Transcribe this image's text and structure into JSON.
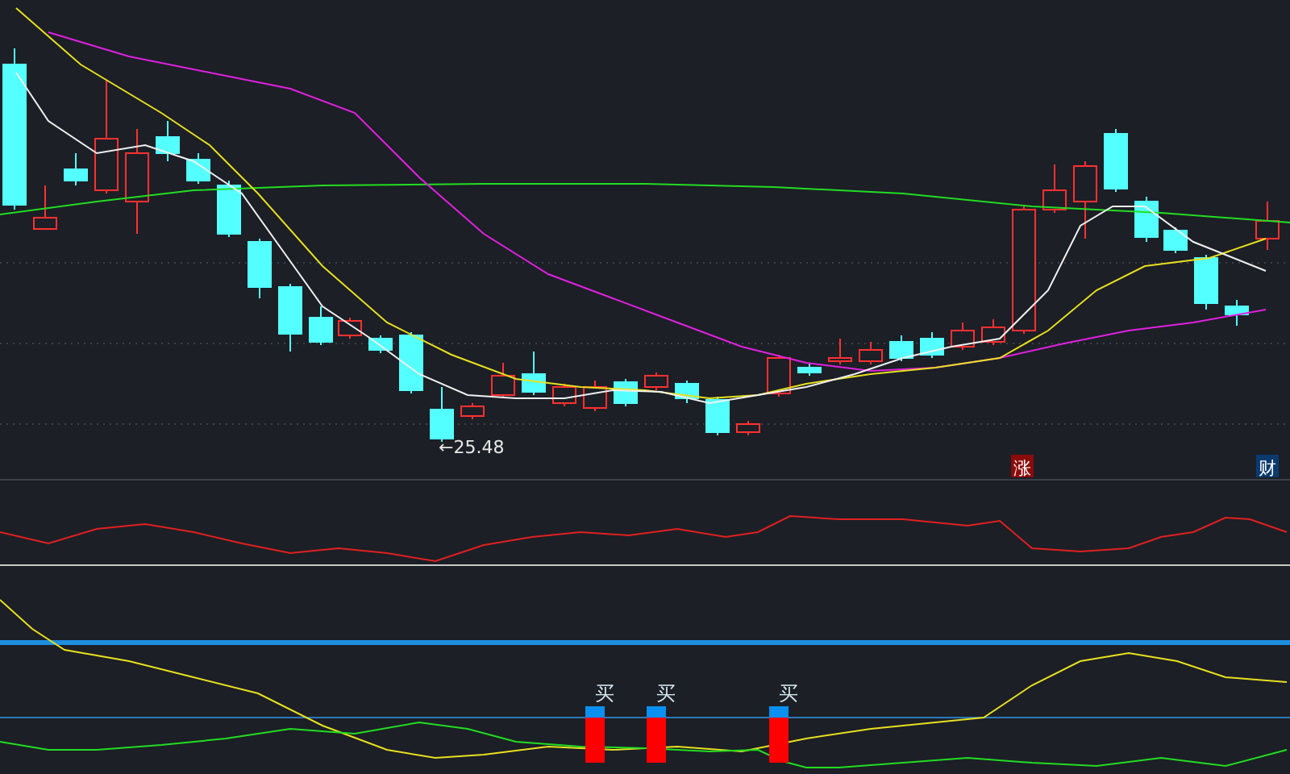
{
  "price_panel": {
    "low_marker": "←25.48",
    "badges": [
      {
        "label": "涨",
        "kind": "rise"
      },
      {
        "label": "财",
        "kind": "finance"
      }
    ]
  },
  "signal_panel": {
    "buy_signals": [
      {
        "label": "买"
      },
      {
        "label": "买"
      },
      {
        "label": "买"
      }
    ]
  }
}
